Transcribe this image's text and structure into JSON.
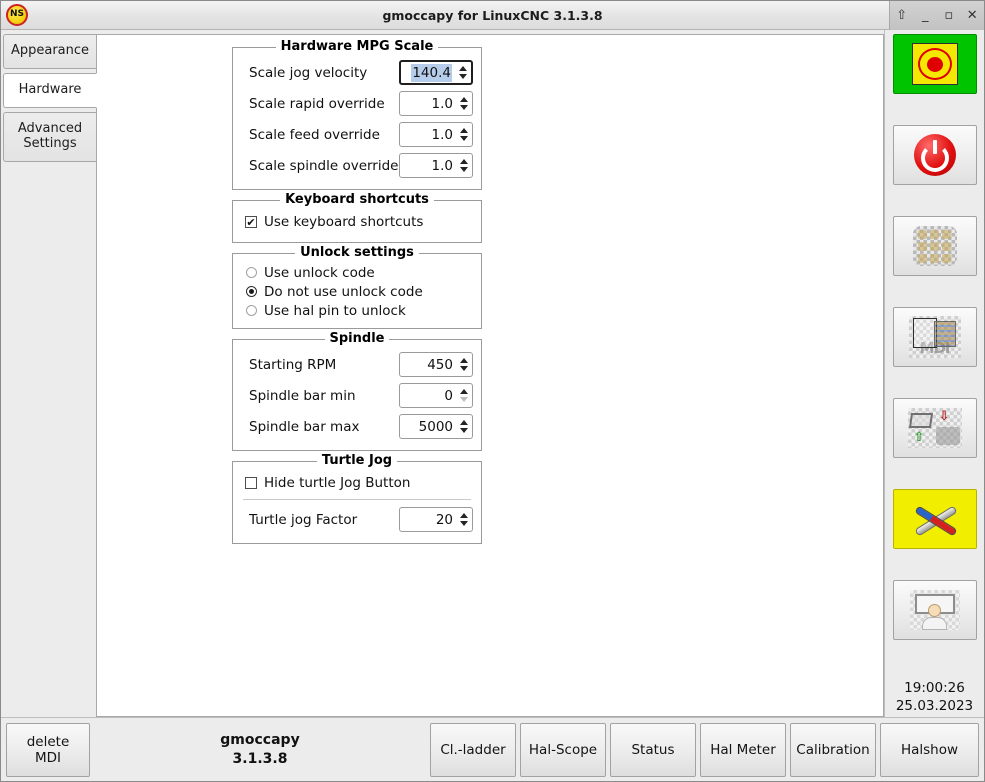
{
  "window": {
    "title": "gmoccapy for LinuxCNC  3.1.3.8",
    "logo_text": "NS",
    "controls": [
      {
        "name": "rollup",
        "glyph": "⇧"
      },
      {
        "name": "minimize",
        "glyph": "_"
      },
      {
        "name": "maximize",
        "glyph": "▫"
      },
      {
        "name": "close",
        "glyph": "✕"
      }
    ]
  },
  "tabs": [
    {
      "label": "Appearance",
      "active": false
    },
    {
      "label": "Hardware",
      "active": true
    },
    {
      "label": "Advanced Settings",
      "active": false
    }
  ],
  "frames": {
    "mpg": {
      "legend": "Hardware MPG Scale",
      "rows": [
        {
          "label": "Scale jog velocity",
          "value": "140.4",
          "focused": true,
          "up_enabled": true,
          "down_enabled": true
        },
        {
          "label": "Scale rapid override",
          "value": "1.0",
          "focused": false,
          "up_enabled": true,
          "down_enabled": true
        },
        {
          "label": "Scale feed override",
          "value": "1.0",
          "focused": false,
          "up_enabled": true,
          "down_enabled": true
        },
        {
          "label": "Scale spindle override",
          "value": "1.0",
          "focused": false,
          "up_enabled": true,
          "down_enabled": true
        }
      ]
    },
    "keyboard": {
      "legend": "Keyboard shortcuts",
      "checkbox": {
        "label": "Use keyboard shortcuts",
        "checked": true,
        "glyph": "✔"
      }
    },
    "unlock": {
      "legend": "Unlock settings",
      "options": [
        {
          "label": "Use unlock code",
          "selected": false
        },
        {
          "label": "Do not use unlock code",
          "selected": true
        },
        {
          "label": "Use hal pin to unlock",
          "selected": false
        }
      ]
    },
    "spindle": {
      "legend": "Spindle",
      "rows": [
        {
          "label": "Starting RPM",
          "value": "450",
          "focused": false,
          "up_enabled": true,
          "down_enabled": true
        },
        {
          "label": "Spindle bar min",
          "value": "0",
          "focused": false,
          "up_enabled": true,
          "down_enabled": false
        },
        {
          "label": "Spindle bar max",
          "value": "5000",
          "focused": false,
          "up_enabled": true,
          "down_enabled": true
        }
      ]
    },
    "turtle": {
      "legend": "Turtle Jog",
      "checkbox": {
        "label": "Hide turtle Jog Button",
        "checked": false,
        "glyph": ""
      },
      "rows": [
        {
          "label": "Turtle jog Factor",
          "value": "20",
          "focused": false,
          "up_enabled": true,
          "down_enabled": true
        }
      ]
    }
  },
  "sidebar": {
    "buttons": [
      {
        "name": "estop-button",
        "icon": "emergency-stop-icon",
        "state": "estop",
        "label": "Emergency Stop"
      },
      {
        "name": "machine-power-button",
        "icon": "power-icon",
        "state": "normal",
        "label": ""
      },
      {
        "name": "manual-mode-button",
        "icon": "keypad-icon",
        "state": "normal",
        "label": ""
      },
      {
        "name": "mdi-mode-button",
        "icon": "mdi-icon",
        "state": "normal",
        "label": "MDI"
      },
      {
        "name": "auto-mode-button",
        "icon": "toolpath-icon",
        "state": "normal",
        "label": ""
      },
      {
        "name": "settings-button",
        "icon": "tools-icon",
        "state": "tools-active",
        "label": ""
      },
      {
        "name": "user-tabs-button",
        "icon": "user-folder-icon",
        "state": "normal",
        "label": ""
      }
    ],
    "clock": {
      "time": "19:00:26",
      "date": "25.03.2023"
    }
  },
  "bottom": {
    "delete_mdi": "delete MDI",
    "version_name": "gmoccapy",
    "version_number": "3.1.3.8",
    "buttons": [
      {
        "label": "Cl.-ladder"
      },
      {
        "label": "Hal-Scope"
      },
      {
        "label": "Status"
      },
      {
        "label": "Hal Meter"
      },
      {
        "label": "Calibration"
      },
      {
        "label": "Halshow"
      }
    ]
  },
  "colors": {
    "estop_green": "#00c400",
    "tools_yellow": "#f2ee00",
    "selection_blue": "#b5cdeb",
    "window_bg": "#ececec"
  }
}
